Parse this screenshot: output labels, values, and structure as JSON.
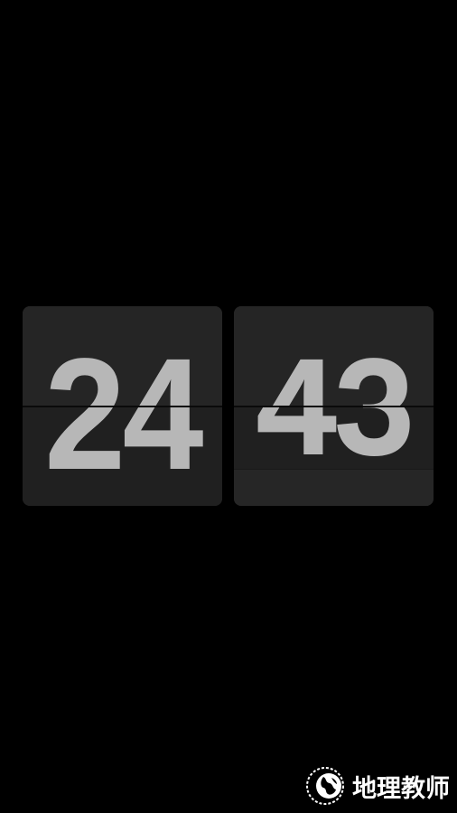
{
  "clock": {
    "hours": "24",
    "minutes": "43"
  },
  "colors": {
    "background": "#000000",
    "card": "#222222",
    "digit": "#b7b7b7"
  },
  "watermark": {
    "logo_icon": "globe-seal-icon",
    "text": "地理教师"
  }
}
